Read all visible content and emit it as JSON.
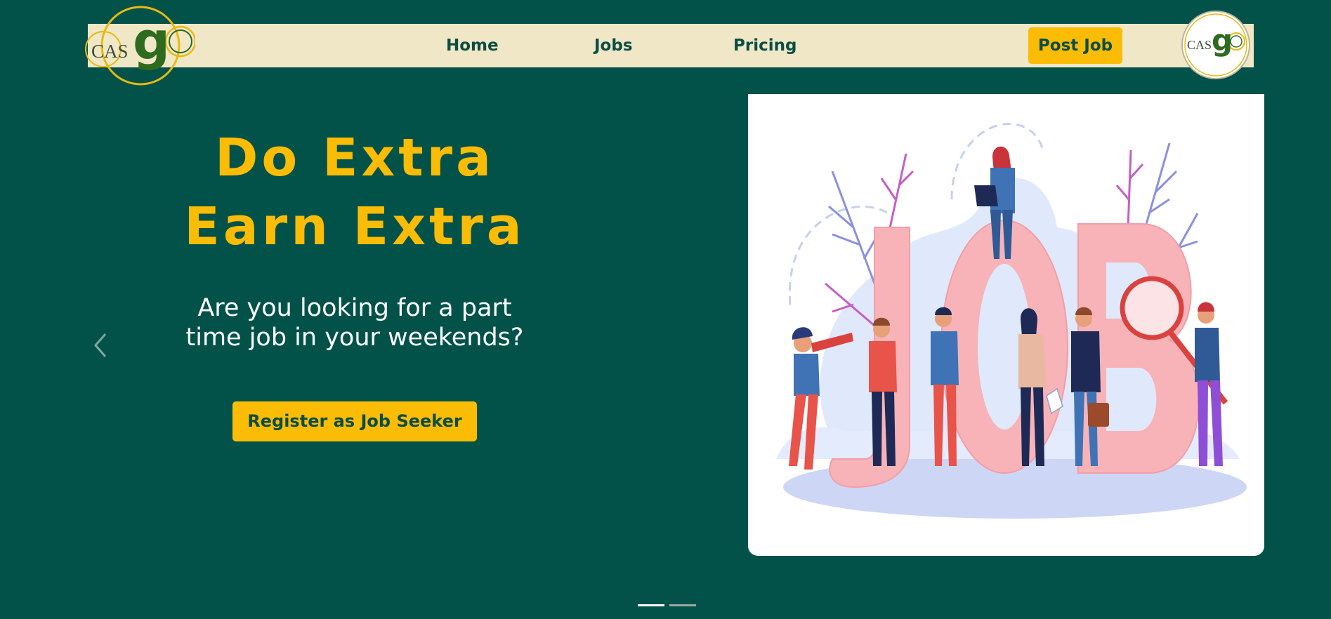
{
  "brand": {
    "logo_prefix": "CAS",
    "logo_suffix": "go",
    "colors": {
      "accent": "#fbbc06",
      "background": "#02524a",
      "nav_bg": "#f0e7c6",
      "text_dark": "#0b4d45"
    }
  },
  "nav": {
    "links": [
      {
        "label": "Home"
      },
      {
        "label": "Jobs"
      },
      {
        "label": "Pricing"
      }
    ],
    "post_job_label": "Post Job"
  },
  "hero": {
    "title_line1": "Do Extra",
    "title_line2": "Earn Extra",
    "subtitle_line1": "Are you looking for a part",
    "subtitle_line2": "time job in your weekends?",
    "register_label": "Register as Job Seeker"
  },
  "illustration": {
    "letters": [
      "J",
      "O",
      "B"
    ],
    "icon": "job-hunting-illustration"
  },
  "carousel": {
    "prev_icon": "chevron-left-icon",
    "slide_count": 2,
    "active_slide": 1
  }
}
